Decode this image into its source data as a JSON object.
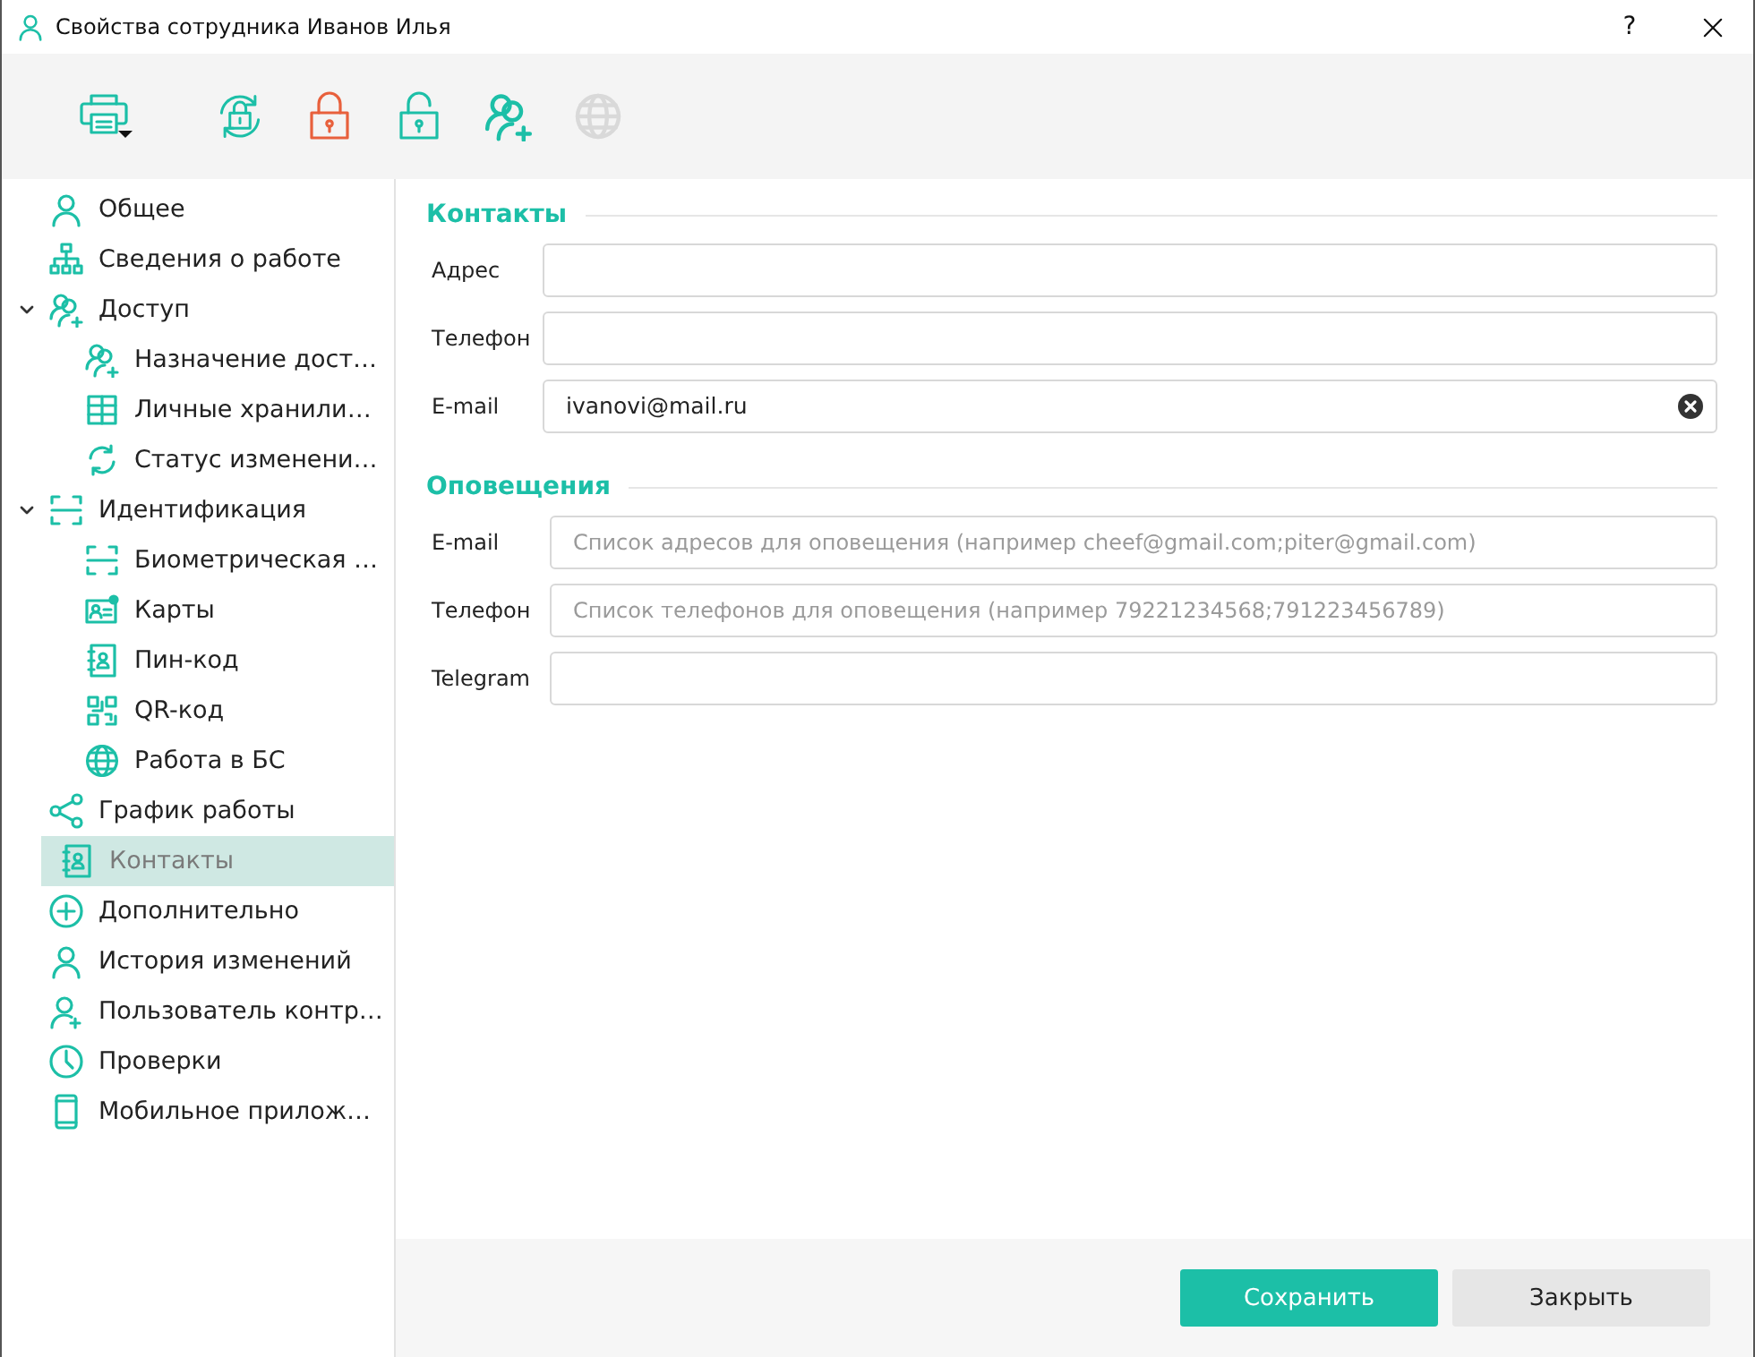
{
  "window": {
    "title": "Свойства сотрудника Иванов Илья",
    "help": "?"
  },
  "toolbar": [
    {
      "disabled": false
    },
    {
      "disabled": false
    },
    {
      "disabled": false
    },
    {
      "disabled": false
    },
    {
      "disabled": false
    },
    {
      "disabled": true
    }
  ],
  "sidebar": {
    "items": [
      {
        "label": "Общее",
        "selected": false
      },
      {
        "label": "Сведения о работе",
        "selected": false
      },
      {
        "label": "Доступ",
        "selected": false,
        "expanded": true,
        "children": [
          {
            "label": "Назначение дост…",
            "selected": false
          },
          {
            "label": "Личные хранили…",
            "selected": false
          },
          {
            "label": "Статус изменени…",
            "selected": false
          }
        ]
      },
      {
        "label": "Идентификация",
        "selected": false,
        "expanded": true,
        "children": [
          {
            "label": "Биометрическая …",
            "selected": false
          },
          {
            "label": "Карты",
            "selected": false
          },
          {
            "label": "Пин-код",
            "selected": false
          },
          {
            "label": "QR-код",
            "selected": false
          },
          {
            "label": "Работа в БС",
            "selected": false
          }
        ]
      },
      {
        "label": "График работы",
        "selected": false
      },
      {
        "label": "Контакты",
        "selected": true
      },
      {
        "label": "Дополнительно",
        "selected": false
      },
      {
        "label": "История изменений",
        "selected": false
      },
      {
        "label": "Пользователь контр…",
        "selected": false
      },
      {
        "label": "Проверки",
        "selected": false
      },
      {
        "label": "Мобильное прилож…",
        "selected": false
      }
    ]
  },
  "sections": [
    {
      "title": "Контакты",
      "fields": [
        {
          "label": "Адрес"
        },
        {
          "label": "Телефон"
        },
        {
          "label": "E-mail",
          "value": "ivanovi@mail.ru"
        }
      ]
    },
    {
      "title": "Оповещения",
      "fields": [
        {
          "label": "E-mail",
          "placeholder": "Список адресов для оповещения (например cheef@gmail.com;piter@gmail.com)"
        },
        {
          "label": "Телефон",
          "placeholder": "Список телефонов для оповещения (например 79221234568;791223456789)"
        },
        {
          "label": "Telegram"
        }
      ]
    }
  ],
  "buttons": [
    {
      "label": "Сохранить",
      "kind": "primary"
    },
    {
      "label": "Закрыть",
      "kind": "secondary"
    }
  ]
}
